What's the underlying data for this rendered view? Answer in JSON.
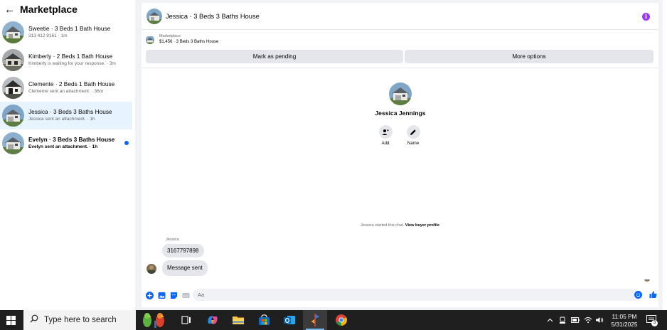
{
  "sidebar": {
    "back_label": "←",
    "title": "Marketplace",
    "conversations": [
      {
        "name": "Sweetie · 3 Beds 1 Bath House",
        "sub": "313 412 9161 · 1m",
        "active": false,
        "unread": false
      },
      {
        "name": "Kimberly · 2 Beds 1 Bath House",
        "sub": "Kimberly is waiting for your response. · 3m",
        "active": false,
        "unread": false
      },
      {
        "name": "Clemente · 2 Beds 1 Bath House",
        "sub": "Clemente sent an attachment. · 36m",
        "active": false,
        "unread": false
      },
      {
        "name": "Jessica · 3 Beds 3 Baths House",
        "sub": "Jessica sent an attachment. · 1h",
        "active": true,
        "unread": false
      },
      {
        "name": "Evelyn · 3 Beds 3 Baths House",
        "sub": "Evelyn sent an attachment. · 1h",
        "active": false,
        "unread": true
      }
    ]
  },
  "chat": {
    "header_title": "Jessica · 3 Beds 3 Baths House",
    "listing_source": "Marketplace",
    "listing_title": "$1,456 · 3 Beds 3 Baths House",
    "mark_pending_label": "Mark as pending",
    "more_options_label": "More options",
    "profile_name": "Jessica Jennings",
    "add_label": "Add",
    "name_label": "Name",
    "system_message": "Jessica started this chat.",
    "view_profile_link": "View buyer profile",
    "sender_label": "Jessica",
    "message_1": "3167797898",
    "message_2": "Message sent",
    "composer_placeholder": "Aa"
  },
  "taskbar": {
    "search_placeholder": "Type here to search",
    "time": "11:05 PM",
    "date": "5/31/2025",
    "notification_count": "3"
  },
  "colors": {
    "accent": "#0866ff",
    "info": "#a033ff",
    "bubble": "#e4e6eb",
    "active_row": "#e7f3ff"
  }
}
